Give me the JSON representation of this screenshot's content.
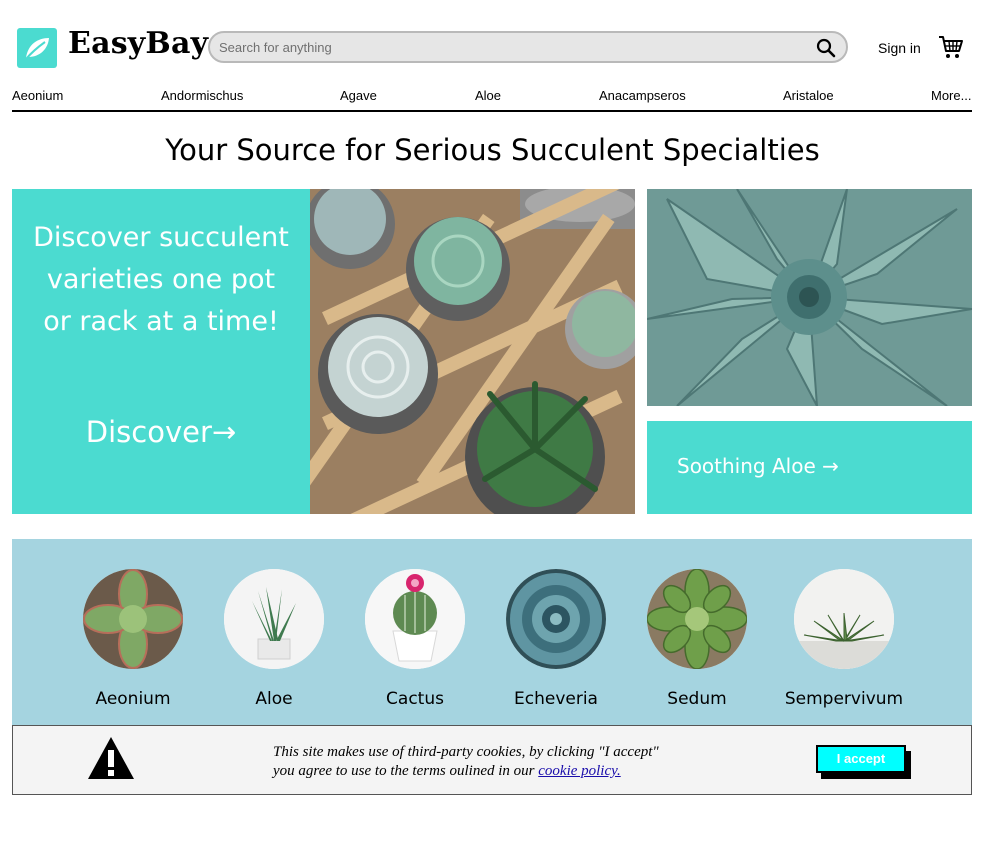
{
  "header": {
    "brand": "EasyBay",
    "logo_icon": "leaf-icon",
    "search_placeholder": "Search for anything",
    "sign_in": "Sign in",
    "cart_icon": "cart-icon"
  },
  "nav": {
    "items": [
      "Aeonium",
      "Andormischus",
      "Agave",
      "Aloe",
      "Anacampseros",
      "Aristaloe"
    ],
    "more": "More..."
  },
  "hero": {
    "title": "Your Source for Serious Succulent Specialties",
    "promo_text": "Discover succulent varieties one pot or rack at a time!",
    "promo_link": "Discover→",
    "side_link": "Soothing Aloe →"
  },
  "categories": [
    {
      "label": "Aeonium",
      "icon": "aeonium-image"
    },
    {
      "label": "Aloe",
      "icon": "aloe-image"
    },
    {
      "label": "Cactus",
      "icon": "cactus-image"
    },
    {
      "label": "Echeveria",
      "icon": "echeveria-image"
    },
    {
      "label": "Sedum",
      "icon": "sedum-image"
    },
    {
      "label": "Sempervivum",
      "icon": "sempervivum-image"
    }
  ],
  "cookie": {
    "line1": "This site makes use of third-party cookies, by clicking \"I accept\"",
    "line2": "you agree to use to the terms oulined in our",
    "link": "cookie policy.",
    "accept": "I accept",
    "warning_icon": "warning-icon"
  },
  "colors": {
    "accent": "#4bdbd0",
    "band": "#a5d4e0",
    "accept_button": "#00ffff"
  }
}
